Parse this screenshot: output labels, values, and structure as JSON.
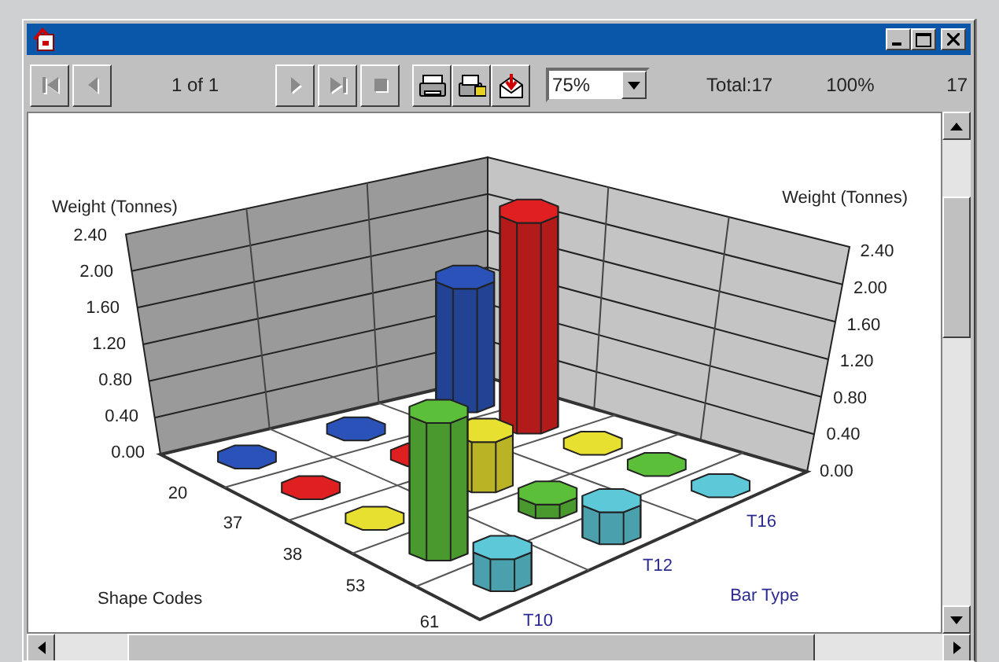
{
  "toolbar": {
    "nav_buttons": [
      {
        "kind": "first",
        "disabled": true
      },
      {
        "kind": "prev",
        "disabled": true
      }
    ],
    "page": "1 of 1",
    "more_buttons": [
      {
        "kind": "next",
        "disabled": true
      },
      {
        "kind": "last",
        "disabled": true
      },
      {
        "kind": "stop",
        "disabled": true
      }
    ],
    "action_buttons": [
      {
        "kind": "print"
      },
      {
        "kind": "export"
      },
      {
        "kind": "mail"
      }
    ],
    "zoom": "75%",
    "total": "Total:17",
    "percent": "100%",
    "count": "17"
  },
  "chart": {
    "left_axis_title": "Weight (Tonnes)",
    "right_axis_title": "Weight (Tonnes)",
    "left_ticks": [
      "2.40",
      "2.00",
      "1.60",
      "1.20",
      "0.80",
      "0.40",
      "0.00"
    ],
    "right_ticks": [
      "2.40",
      "2.00",
      "1.60",
      "1.20",
      "0.80",
      "0.40",
      "0.00"
    ],
    "shape_axis_title": "Shape Codes",
    "shape_codes": [
      {
        "label": "20",
        "color": "#2a52b8"
      },
      {
        "label": "37",
        "color": "#e02020"
      },
      {
        "label": "38",
        "color": "#e8e030"
      },
      {
        "label": "53",
        "color": "#5cbf3a"
      },
      {
        "label": "61",
        "color": "#5cc8d8"
      }
    ],
    "bar_axis_title": "Bar Type",
    "bar_types": [
      "T10",
      "T12",
      "T16"
    ]
  }
}
